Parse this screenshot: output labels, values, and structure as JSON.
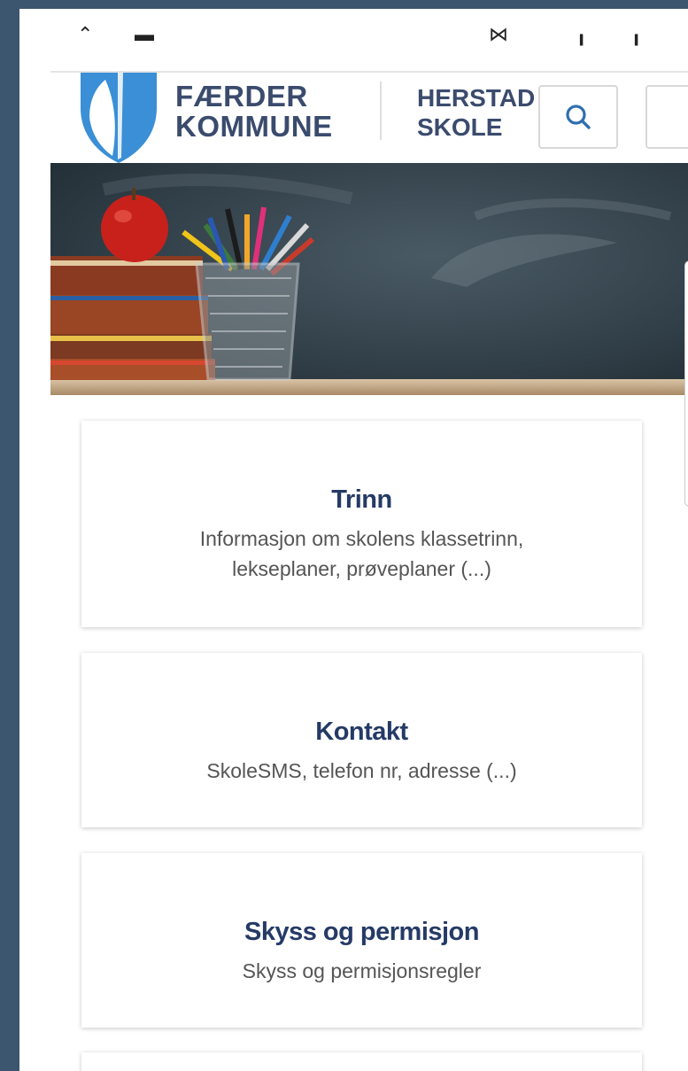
{
  "header": {
    "municipality_line1": "FÆRDER",
    "municipality_line2": "KOMMUNE",
    "school_line1": "HERSTAD",
    "school_line2": "SKOLE",
    "search_icon": "search-icon",
    "brand_color": "#3a8fd6",
    "text_color": "#3a4b6d"
  },
  "banner": {
    "image": "school-supplies-chalkboard-banner"
  },
  "cards": [
    {
      "title": "Trinn",
      "description": "Informasjon om skolens klassetrinn, lekseplaner, prøveplaner (...)"
    },
    {
      "title": "Kontakt",
      "description": "SkoleSMS, telefon nr, adresse (...)"
    },
    {
      "title": "Skyss og permisjon",
      "description": "Skyss og permisjonsregler"
    }
  ],
  "colors": {
    "frame": "#3d5670",
    "card_title": "#253a66"
  }
}
